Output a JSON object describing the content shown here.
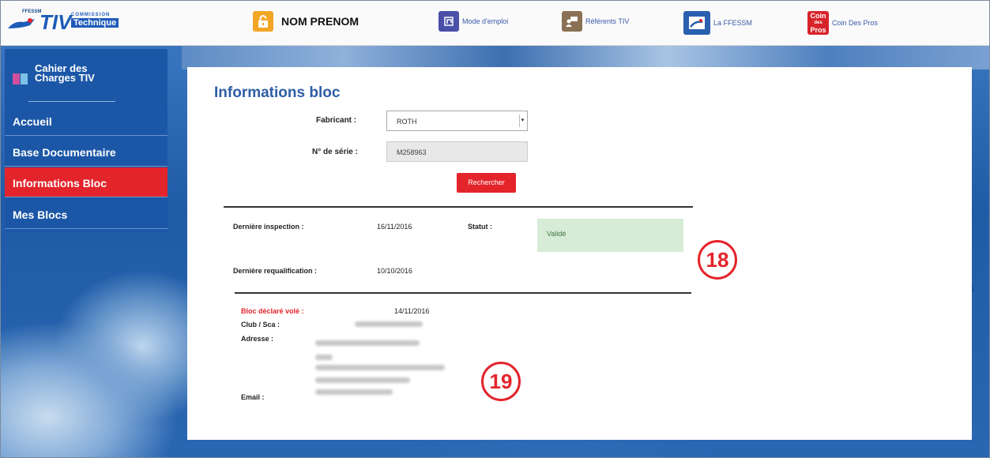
{
  "header": {
    "logo_small": "FFESSM",
    "logo_tiv": "TIV",
    "logo_commission": "COMMISSION",
    "logo_technique": "Technique",
    "user_name": "NOM PRENOM",
    "nav": [
      {
        "label": "Mode d'emploi",
        "icon": "manual-icon"
      },
      {
        "label": "Référents TIV",
        "icon": "referents-icon"
      },
      {
        "label": "La FFESSM",
        "icon": "ffessm-icon"
      },
      {
        "label": "Coin Des Pros",
        "icon": "coin-des-pros-icon"
      }
    ],
    "pros_icon_text": [
      "Coin",
      "des",
      "Pros"
    ]
  },
  "sidebar": {
    "title": "Cahier des Charges TIV",
    "items": [
      {
        "label": "Accueil",
        "active": false
      },
      {
        "label": "Base Documentaire",
        "active": false
      },
      {
        "label": "Informations Bloc",
        "active": true
      },
      {
        "label": "Mes Blocs",
        "active": false
      }
    ]
  },
  "main": {
    "title": "Informations bloc",
    "fabricant_label": "Fabricant :",
    "fabricant_value": "ROTH",
    "serie_label": "N° de série :",
    "serie_value": "M258963",
    "search_button": "Rechercher",
    "inspection_label": "Dernière inspection :",
    "inspection_date": "16/11/2016",
    "statut_label": "Statut :",
    "statut_value": "Validé",
    "requalification_label": "Dernière requalification :",
    "requalification_date": "10/10/2016",
    "stolen_label": "Bloc déclaré volé :",
    "stolen_date": "14/11/2016",
    "club_label": "Club / Sca :",
    "address_label": "Adresse :",
    "email_label": "Email :"
  },
  "callouts": [
    "18",
    "19"
  ],
  "colors": {
    "accent_red": "#e3242b",
    "sidebar_blue": "#1b57a6",
    "title_blue": "#2f5ea6",
    "status_green": "#d6ecd6"
  }
}
